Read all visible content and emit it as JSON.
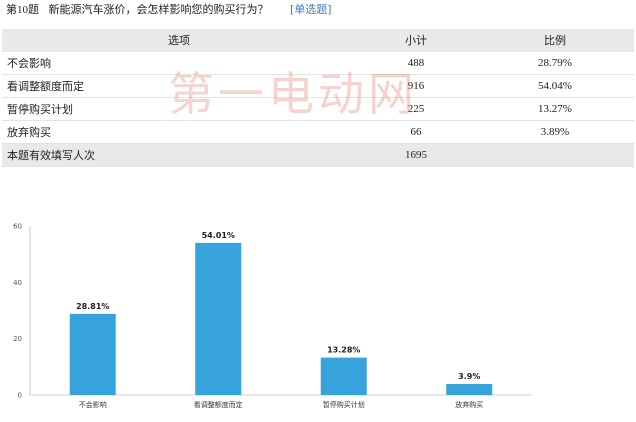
{
  "question": {
    "number_prefix": "第",
    "number": "10",
    "number_suffix": "题",
    "text": "新能源汽车涨价，会怎样影响您的购买行为？",
    "type_tag": "[单选题]"
  },
  "table": {
    "headers": [
      "选项",
      "小计",
      "比例"
    ],
    "rows": [
      {
        "option": "不会影响",
        "count": "488",
        "ratio": "28.79%"
      },
      {
        "option": "看调整额度而定",
        "count": "916",
        "ratio": "54.04%"
      },
      {
        "option": "暂停购买计划",
        "count": "225",
        "ratio": "13.27%"
      },
      {
        "option": "放弃购买",
        "count": "66",
        "ratio": "3.89%"
      }
    ],
    "total": {
      "label": "本题有效填写人次",
      "count": "1695"
    }
  },
  "watermark": "第一电动网",
  "chart_data": {
    "type": "bar",
    "categories": [
      "不会影响",
      "看调整额度而定",
      "暂停购买计划",
      "放弃购买"
    ],
    "values": [
      28.81,
      54.01,
      13.28,
      3.9
    ],
    "data_labels": [
      "28.81%",
      "54.01%",
      "13.28%",
      "3.9%"
    ],
    "yticks": [
      "0",
      "20",
      "40",
      "60"
    ],
    "ylim": [
      0,
      60
    ],
    "bar_color": "#36a3dc",
    "grid": false
  }
}
